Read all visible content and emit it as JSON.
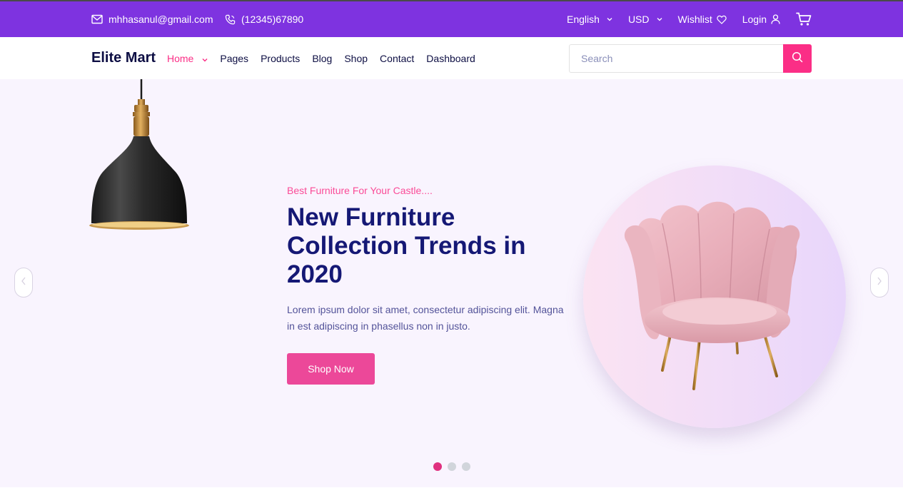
{
  "topbar": {
    "email": "mhhasanul@gmail.com",
    "phone": "(12345)67890",
    "language": "English",
    "currency": "USD",
    "wishlist": "Wishlist",
    "login": "Login"
  },
  "nav": {
    "brand": "Elite Mart",
    "items": [
      {
        "label": "Home",
        "active": true,
        "dropdown": true
      },
      {
        "label": "Pages"
      },
      {
        "label": "Products"
      },
      {
        "label": "Blog"
      },
      {
        "label": "Shop"
      },
      {
        "label": "Contact"
      },
      {
        "label": "Dashboard"
      }
    ],
    "search": {
      "placeholder": "Search",
      "value": ""
    }
  },
  "hero": {
    "subtitle": "Best Furniture For Your Castle....",
    "title": "New Furniture Collection Trends in 2020",
    "description": "Lorem ipsum dolor sit amet, consectetur adipiscing elit. Magna in est adipiscing in phasellus non in justo.",
    "button": "Shop Now",
    "slides": {
      "count": 3,
      "active": 1
    }
  },
  "colors": {
    "topbar": "#7e33e0",
    "accent": "#fb2e86",
    "heading": "#151875",
    "hero_bg": "#f9f4fe"
  },
  "icons": [
    "mail-icon",
    "phone-icon",
    "chevron-down-icon",
    "heart-icon",
    "user-icon",
    "cart-icon",
    "search-icon",
    "chevron-left-icon",
    "chevron-right-icon"
  ]
}
